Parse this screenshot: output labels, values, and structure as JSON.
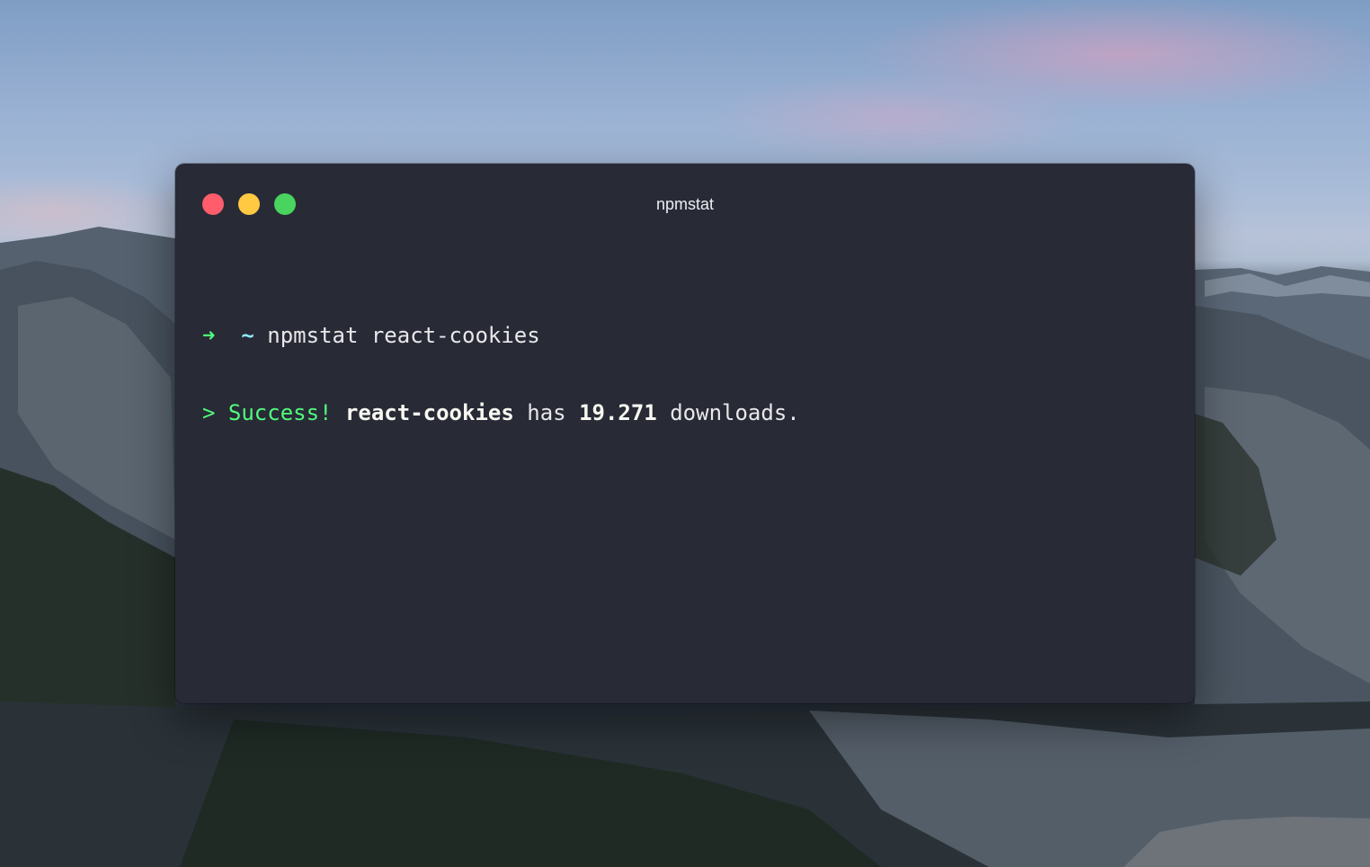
{
  "window": {
    "title": "npmstat",
    "buttons": {
      "close": "close",
      "minimize": "minimize",
      "maximize": "maximize"
    }
  },
  "terminal": {
    "line1": {
      "prompt_arrow": "➜",
      "cwd": "~",
      "command": "npmstat react-cookies"
    },
    "line2": {
      "marker": ">",
      "status": "Success!",
      "package": "react-cookies",
      "verb": "has",
      "count": "19.271",
      "unit": "downloads."
    }
  },
  "colors": {
    "window_bg": "#282a36",
    "green": "#50fa7b",
    "cyan": "#8be9fd",
    "close": "#ff5c6c",
    "minimize": "#ffc942",
    "maximize": "#49d35f"
  }
}
